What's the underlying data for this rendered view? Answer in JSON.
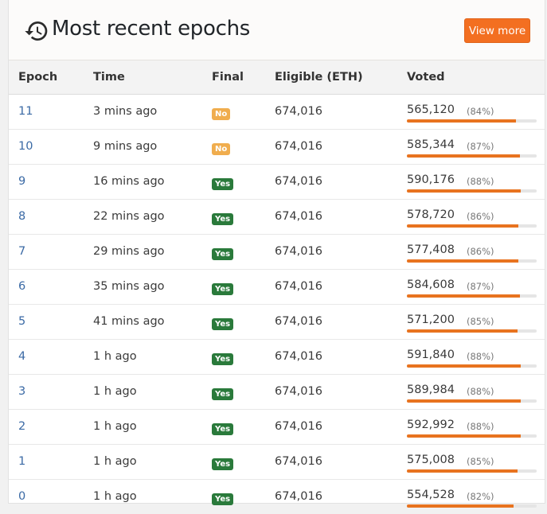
{
  "header": {
    "title": "Most recent epochs",
    "view_more_label": "View more"
  },
  "columns": [
    "Epoch",
    "Time",
    "Final",
    "Eligible (ETH)",
    "Voted"
  ],
  "colors": {
    "accent": "#f36f21",
    "final_yes": "#2a7a3b",
    "final_no": "#f0ad4e",
    "bar": "#e8731f"
  },
  "rows": [
    {
      "epoch": "11",
      "time": "3 mins ago",
      "final": "No",
      "eligible": "674,016",
      "voted": "565,120",
      "pct": "(84%)",
      "fraction": 0.84
    },
    {
      "epoch": "10",
      "time": "9 mins ago",
      "final": "No",
      "eligible": "674,016",
      "voted": "585,344",
      "pct": "(87%)",
      "fraction": 0.87
    },
    {
      "epoch": "9",
      "time": "16 mins ago",
      "final": "Yes",
      "eligible": "674,016",
      "voted": "590,176",
      "pct": "(88%)",
      "fraction": 0.88
    },
    {
      "epoch": "8",
      "time": "22 mins ago",
      "final": "Yes",
      "eligible": "674,016",
      "voted": "578,720",
      "pct": "(86%)",
      "fraction": 0.86
    },
    {
      "epoch": "7",
      "time": "29 mins ago",
      "final": "Yes",
      "eligible": "674,016",
      "voted": "577,408",
      "pct": "(86%)",
      "fraction": 0.86
    },
    {
      "epoch": "6",
      "time": "35 mins ago",
      "final": "Yes",
      "eligible": "674,016",
      "voted": "584,608",
      "pct": "(87%)",
      "fraction": 0.87
    },
    {
      "epoch": "5",
      "time": "41 mins ago",
      "final": "Yes",
      "eligible": "674,016",
      "voted": "571,200",
      "pct": "(85%)",
      "fraction": 0.85
    },
    {
      "epoch": "4",
      "time": "1 h ago",
      "final": "Yes",
      "eligible": "674,016",
      "voted": "591,840",
      "pct": "(88%)",
      "fraction": 0.88
    },
    {
      "epoch": "3",
      "time": "1 h ago",
      "final": "Yes",
      "eligible": "674,016",
      "voted": "589,984",
      "pct": "(88%)",
      "fraction": 0.88
    },
    {
      "epoch": "2",
      "time": "1 h ago",
      "final": "Yes",
      "eligible": "674,016",
      "voted": "592,992",
      "pct": "(88%)",
      "fraction": 0.88
    },
    {
      "epoch": "1",
      "time": "1 h ago",
      "final": "Yes",
      "eligible": "674,016",
      "voted": "575,008",
      "pct": "(85%)",
      "fraction": 0.85
    },
    {
      "epoch": "0",
      "time": "1 h ago",
      "final": "Yes",
      "eligible": "674,016",
      "voted": "554,528",
      "pct": "(82%)",
      "fraction": 0.82
    }
  ]
}
